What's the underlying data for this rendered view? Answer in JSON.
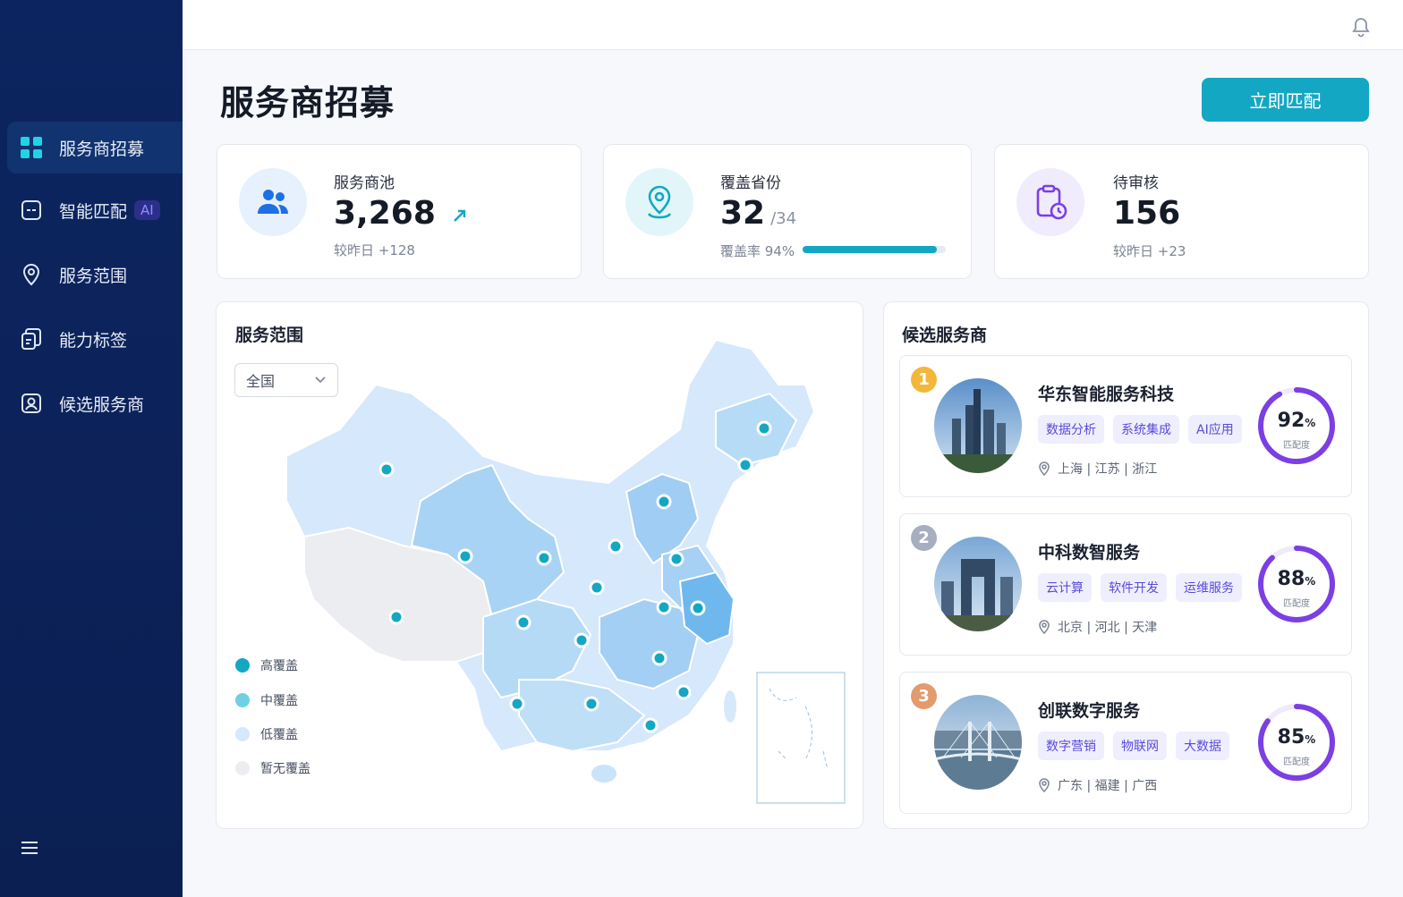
{
  "sidebar": {
    "items": [
      {
        "label": "服务商招募"
      },
      {
        "label": "智能匹配",
        "badge": "AI"
      },
      {
        "label": "服务范围"
      },
      {
        "label": "能力标签"
      },
      {
        "label": "候选服务商"
      }
    ]
  },
  "page": {
    "title": "服务商招募",
    "match_button": "立即匹配"
  },
  "stats": {
    "pool": {
      "label": "服务商池",
      "value": "3,268",
      "sub": "较昨日 +128"
    },
    "coverage": {
      "label": "覆盖省份",
      "value": "32",
      "total": "/34",
      "sub": "覆盖率 94%",
      "rate": 94
    },
    "pending": {
      "label": "待审核",
      "value": "156",
      "sub": "较昨日 +23"
    }
  },
  "map_panel": {
    "title": "服务范围",
    "region_select": "全国",
    "legend": [
      "高覆盖",
      "中覆盖",
      "低覆盖",
      "暂无覆盖"
    ]
  },
  "candidates": {
    "title": "候选服务商",
    "items": [
      {
        "rank": "1",
        "name": "华东智能服务科技",
        "tags": [
          "数据分析",
          "系统集成",
          "AI应用"
        ],
        "location": "上海 | 江苏 | 浙江",
        "score": "92",
        "score_pct": 92,
        "unit": "%",
        "score_label": "匹配度"
      },
      {
        "rank": "2",
        "name": "中科数智服务",
        "tags": [
          "云计算",
          "软件开发",
          "运维服务"
        ],
        "location": "北京 | 河北 | 天津",
        "score": "88",
        "score_pct": 88,
        "unit": "%",
        "score_label": "匹配度"
      },
      {
        "rank": "3",
        "name": "创联数字服务",
        "tags": [
          "数字营销",
          "物联网",
          "大数据"
        ],
        "location": "广东 | 福建 | 广西",
        "score": "85",
        "score_pct": 85,
        "unit": "%",
        "score_label": "匹配度"
      }
    ]
  },
  "colors": {
    "accent": "#14a7c3",
    "ring": "#7b3fe4",
    "rank1": "#f3b73a",
    "rank2": "#a6aec0",
    "rank3": "#e39a6d"
  }
}
